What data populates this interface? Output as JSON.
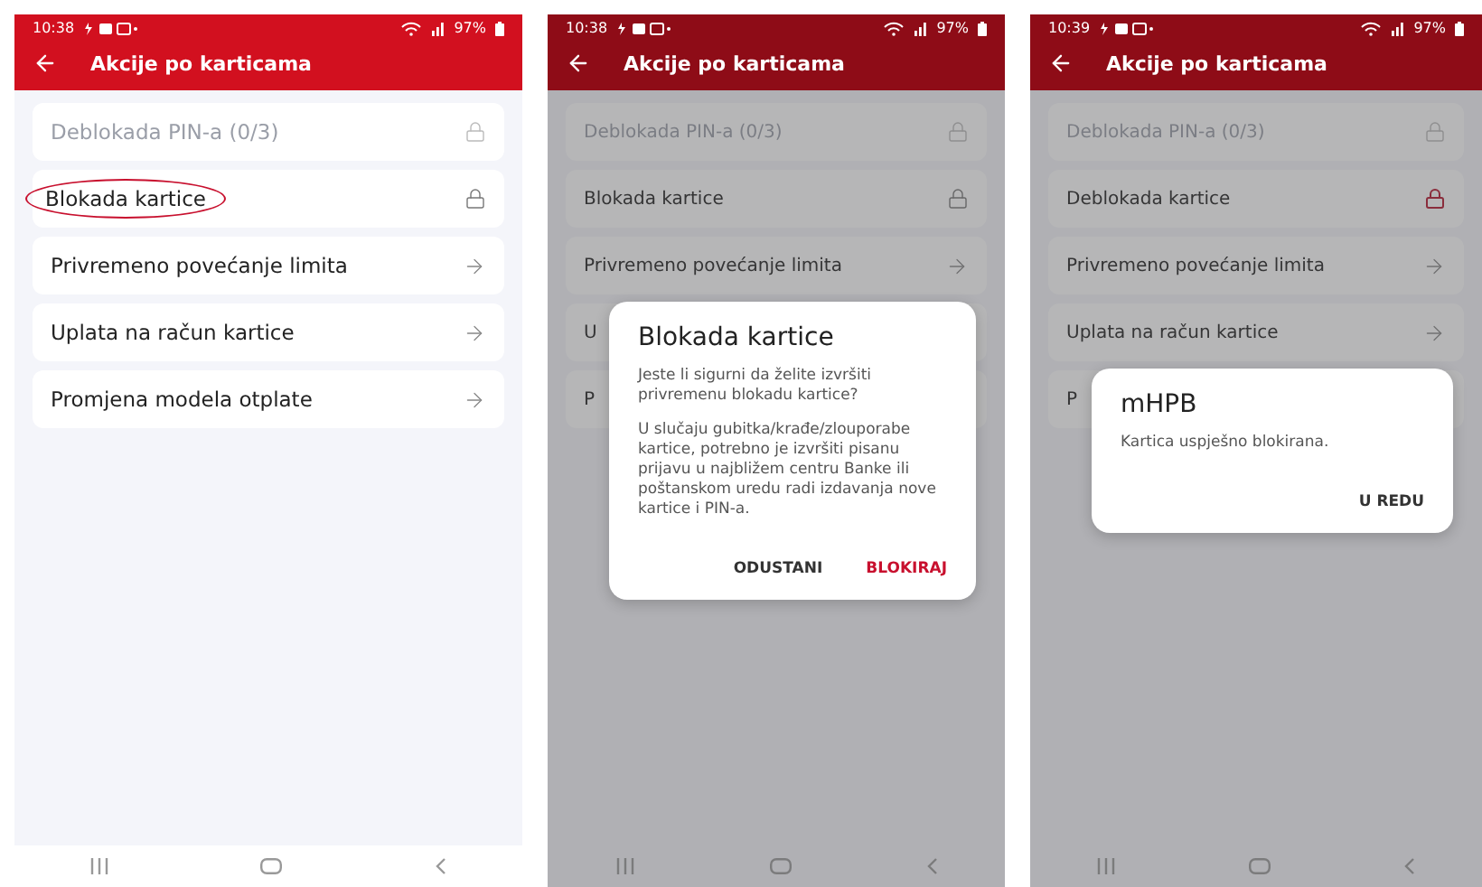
{
  "phones": [
    {
      "time": "10:38",
      "battery": "97%",
      "title": "Akcije po karticama",
      "dimmed": false,
      "items": [
        {
          "label": "Deblokada PIN-a (0/3)",
          "disabled": true,
          "kind": "lock",
          "highlighted": false,
          "circled": false
        },
        {
          "label": "Blokada kartice",
          "disabled": false,
          "kind": "lock",
          "highlighted": false,
          "circled": true
        },
        {
          "label": "Privremeno povećanje limita",
          "disabled": false,
          "kind": "arrow",
          "circled": false
        },
        {
          "label": "Uplata na račun kartice",
          "disabled": false,
          "kind": "arrow",
          "circled": false
        },
        {
          "label": "Promjena modela otplate",
          "disabled": false,
          "kind": "arrow",
          "circled": false
        }
      ]
    },
    {
      "time": "10:38",
      "battery": "97%",
      "title": "Akcije po karticama",
      "dimmed": true,
      "items": [
        {
          "label": "Deblokada PIN-a (0/3)",
          "disabled": true,
          "kind": "lock",
          "highlighted": false,
          "circled": false
        },
        {
          "label": "Blokada kartice",
          "disabled": false,
          "kind": "lock",
          "highlighted": false,
          "circled": false
        },
        {
          "label": "Privremeno povećanje limita",
          "disabled": false,
          "kind": "arrow",
          "circled": false
        },
        {
          "label": "U",
          "disabled": false,
          "kind": "covered",
          "circled": false
        },
        {
          "label": "P",
          "disabled": false,
          "kind": "covered",
          "circled": false
        }
      ],
      "dialog": {
        "title": "Blokada kartice",
        "paragraphs": [
          "Jeste li sigurni da želite izvršiti privremenu blokadu kartice?",
          "U slučaju gubitka/krađe/zlouporabe kartice, potrebno je izvršiti pisanu prijavu u najbližem centru Banke ili poštanskom uredu radi izdavanja nove kartice i PIN-a."
        ],
        "buttons": [
          {
            "label": "ODUSTANI",
            "kind": "neutral"
          },
          {
            "label": "BLOKIRAJ",
            "kind": "primary"
          }
        ]
      }
    },
    {
      "time": "10:39",
      "battery": "97%",
      "title": "Akcije po karticama",
      "dimmed": true,
      "items": [
        {
          "label": "Deblokada PIN-a (0/3)",
          "disabled": true,
          "kind": "lock",
          "highlighted": false,
          "circled": false
        },
        {
          "label": "Deblokada kartice",
          "disabled": false,
          "kind": "lock",
          "highlighted": true,
          "circled": false
        },
        {
          "label": "Privremeno povećanje limita",
          "disabled": false,
          "kind": "arrow",
          "circled": false
        },
        {
          "label": "Uplata na račun kartice",
          "disabled": false,
          "kind": "arrow",
          "circled": false
        },
        {
          "label": "P",
          "disabled": false,
          "kind": "covered",
          "circled": false
        }
      ],
      "dialog": {
        "title": "mHPB",
        "paragraphs": [
          "Kartica uspješno blokirana."
        ],
        "buttons": [
          {
            "label": "U REDU",
            "kind": "neutral"
          }
        ]
      }
    }
  ]
}
